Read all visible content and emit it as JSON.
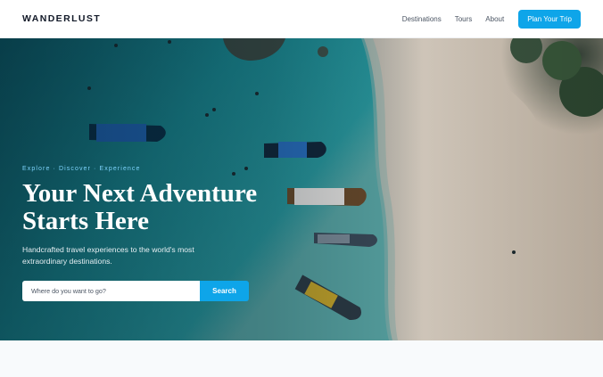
{
  "header": {
    "brand": "WANDERLUST",
    "nav": [
      "Destinations",
      "Tours",
      "About"
    ],
    "cta_label": "Plan Your Trip"
  },
  "hero": {
    "tagline": "Explore · Discover · Experience",
    "headline_line1": "Your Next Adventure",
    "headline_line2": "Starts Here",
    "subtext": "Handcrafted travel experiences to the world's most extraordinary destinations.",
    "search_placeholder": "Where do you want to go?",
    "search_button": "Search"
  },
  "colors": {
    "accent": "#0ea5e9",
    "tagline": "#7dd3fc",
    "water": "#17707a",
    "sand": "#d8cfc2"
  }
}
